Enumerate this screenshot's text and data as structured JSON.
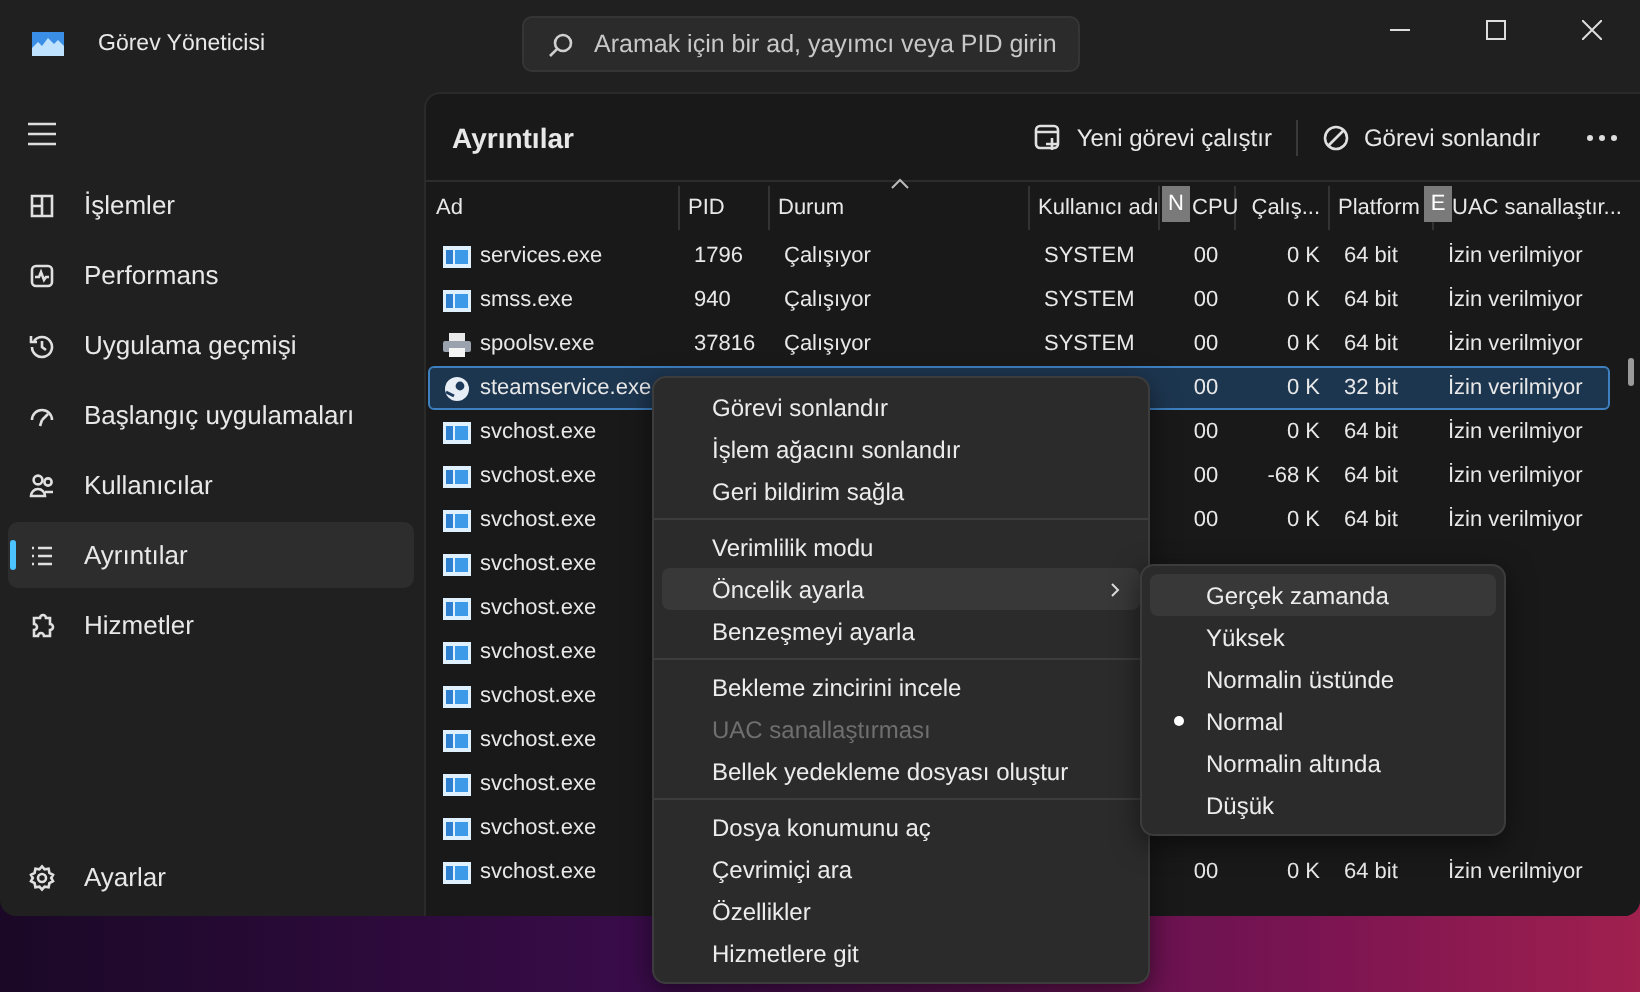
{
  "window": {
    "title": "Görev Yöneticisi"
  },
  "search": {
    "placeholder": "Aramak için bir ad, yayımcı veya PID girin"
  },
  "sidebar": {
    "items": [
      {
        "label": "İşlemler",
        "selected": false
      },
      {
        "label": "Performans",
        "selected": false
      },
      {
        "label": "Uygulama geçmişi",
        "selected": false
      },
      {
        "label": "Başlangıç uygulamaları",
        "selected": false
      },
      {
        "label": "Kullanıcılar",
        "selected": false
      },
      {
        "label": "Ayrıntılar",
        "selected": true
      },
      {
        "label": "Hizmetler",
        "selected": false
      }
    ],
    "footer": {
      "label": "Ayarlar"
    }
  },
  "panel": {
    "title": "Ayrıntılar",
    "actions": [
      {
        "kind": "run",
        "label": "Yeni görevi çalıştır"
      },
      {
        "kind": "end",
        "label": "Görevi sonlandır"
      }
    ]
  },
  "table": {
    "columns": [
      {
        "label": "Ad"
      },
      {
        "label": "PID"
      },
      {
        "label": "Durum",
        "sorted": true
      },
      {
        "label": "Kullanıcı adı"
      },
      {
        "label": "CPU",
        "key_tip": "N"
      },
      {
        "label": "Çalış..."
      },
      {
        "label": "Platform"
      },
      {
        "label": "UAC sanallaştır...",
        "key_tip": "E"
      }
    ],
    "rows": [
      {
        "kind": "service",
        "selected": false,
        "cells": [
          "services.exe",
          "1796",
          "Çalışıyor",
          "SYSTEM",
          "00",
          "0 K",
          "64 bit",
          "İzin verilmiyor"
        ]
      },
      {
        "kind": "service",
        "selected": false,
        "cells": [
          "smss.exe",
          "940",
          "Çalışıyor",
          "SYSTEM",
          "00",
          "0 K",
          "64 bit",
          "İzin verilmiyor"
        ]
      },
      {
        "kind": "printer",
        "selected": false,
        "cells": [
          "spoolsv.exe",
          "37816",
          "Çalışıyor",
          "SYSTEM",
          "00",
          "0 K",
          "64 bit",
          "İzin verilmiyor"
        ]
      },
      {
        "kind": "steam",
        "selected": true,
        "cells": [
          "steamservice.exe",
          null,
          null,
          null,
          "00",
          "0 K",
          "32 bit",
          "İzin verilmiyor"
        ]
      },
      {
        "kind": "service",
        "selected": false,
        "cells": [
          "svchost.exe",
          null,
          null,
          null,
          "00",
          "0 K",
          "64 bit",
          "İzin verilmiyor"
        ]
      },
      {
        "kind": "service",
        "selected": false,
        "cells": [
          "svchost.exe",
          null,
          null,
          null,
          "00",
          "-68 K",
          "64 bit",
          "İzin verilmiyor"
        ]
      },
      {
        "kind": "service",
        "selected": false,
        "cells": [
          "svchost.exe",
          null,
          null,
          null,
          "00",
          "0 K",
          "64 bit",
          "İzin verilmiyor"
        ]
      },
      {
        "kind": "service",
        "selected": false,
        "cells": [
          "svchost.exe"
        ]
      },
      {
        "kind": "service",
        "selected": false,
        "cells": [
          "svchost.exe"
        ]
      },
      {
        "kind": "service",
        "selected": false,
        "cells": [
          "svchost.exe"
        ]
      },
      {
        "kind": "service",
        "selected": false,
        "cells": [
          "svchost.exe"
        ]
      },
      {
        "kind": "service",
        "selected": false,
        "cells": [
          "svchost.exe"
        ]
      },
      {
        "kind": "service",
        "selected": false,
        "cells": [
          "svchost.exe"
        ]
      },
      {
        "kind": "service",
        "selected": false,
        "cells": [
          "svchost.exe"
        ]
      },
      {
        "kind": "service",
        "selected": false,
        "cells": [
          "svchost.exe",
          null,
          null,
          null,
          "00",
          "0 K",
          "64 bit",
          "İzin verilmiyor"
        ]
      }
    ]
  },
  "context_menu": {
    "items": [
      {
        "kind": "item",
        "label": "Görevi sonlandır",
        "disabled": false,
        "highlighted": false
      },
      {
        "kind": "item",
        "label": "İşlem ağacını sonlandır",
        "disabled": false,
        "highlighted": false
      },
      {
        "kind": "item",
        "label": "Geri bildirim sağla",
        "disabled": false,
        "highlighted": false
      },
      {
        "kind": "separator"
      },
      {
        "kind": "item",
        "label": "Verimlilik modu",
        "disabled": false,
        "highlighted": false
      },
      {
        "kind": "submenu",
        "label": "Öncelik ayarla",
        "disabled": false,
        "highlighted": true
      },
      {
        "kind": "item",
        "label": "Benzeşmeyi ayarla",
        "disabled": false,
        "highlighted": false
      },
      {
        "kind": "separator"
      },
      {
        "kind": "item",
        "label": "Bekleme zincirini incele",
        "disabled": false,
        "highlighted": false
      },
      {
        "kind": "item",
        "label": "UAC sanallaştırması",
        "disabled": true,
        "highlighted": false
      },
      {
        "kind": "item",
        "label": "Bellek yedekleme dosyası oluştur",
        "disabled": false,
        "highlighted": false
      },
      {
        "kind": "separator"
      },
      {
        "kind": "item",
        "label": "Dosya konumunu aç",
        "disabled": false,
        "highlighted": false
      },
      {
        "kind": "item",
        "label": "Çevrimiçi ara",
        "disabled": false,
        "highlighted": false
      },
      {
        "kind": "item",
        "label": "Özellikler",
        "disabled": false,
        "highlighted": false
      },
      {
        "kind": "item",
        "label": "Hizmetlere git",
        "disabled": false,
        "highlighted": false
      }
    ]
  },
  "submenu": {
    "items": [
      {
        "label": "Gerçek zamanda",
        "selected": false,
        "highlighted": true
      },
      {
        "label": "Yüksek",
        "selected": false,
        "highlighted": false
      },
      {
        "label": "Normalin üstünde",
        "selected": false,
        "highlighted": false
      },
      {
        "label": "Normal",
        "selected": true,
        "highlighted": false
      },
      {
        "label": "Normalin altında",
        "selected": false,
        "highlighted": false
      },
      {
        "label": "Düşük",
        "selected": false,
        "highlighted": false
      }
    ]
  }
}
